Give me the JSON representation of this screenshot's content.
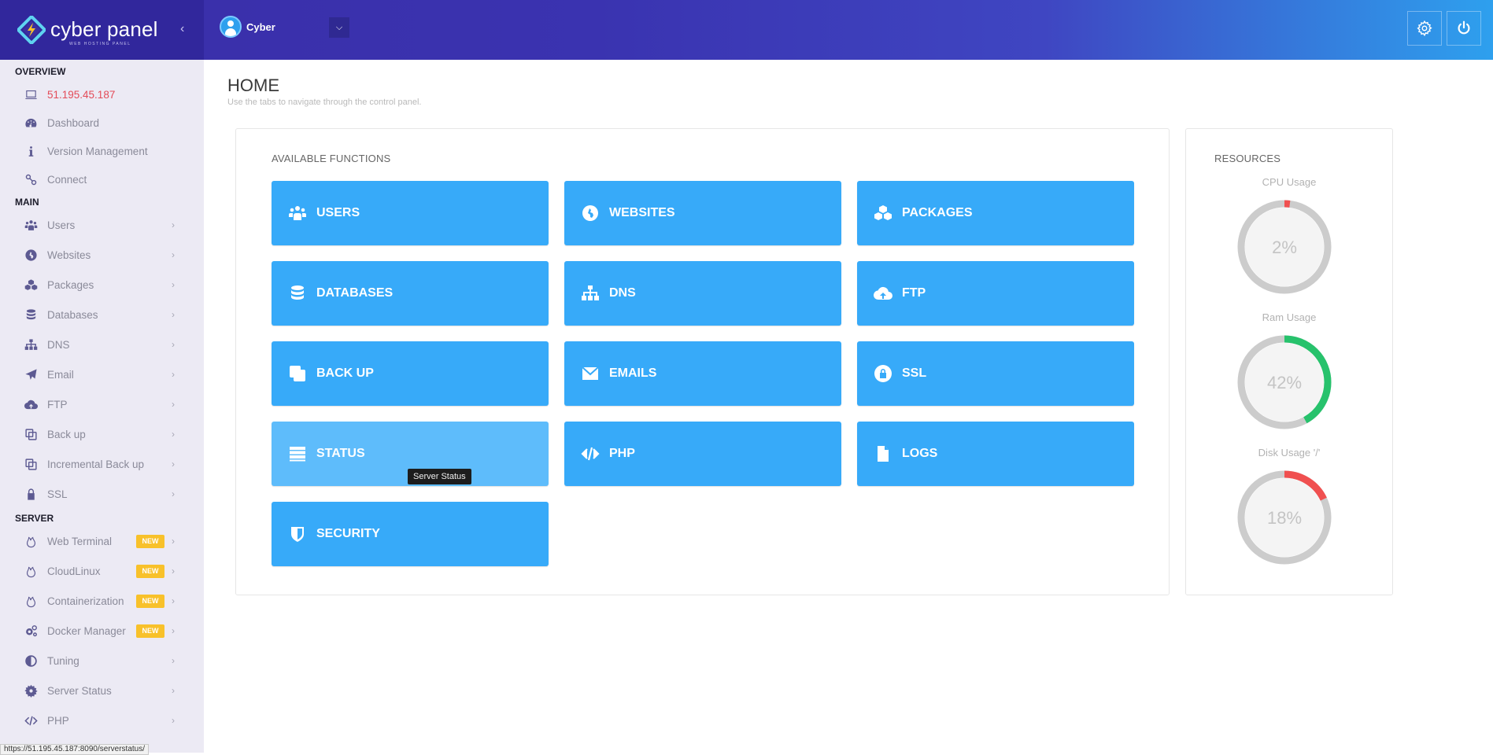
{
  "header": {
    "logo_text": "cyber panel",
    "logo_sub": "WEB HOSTING PANEL",
    "user_name": "Cyber",
    "collapse_icon": "chevron-left-icon",
    "dropdown_icon": "chevron-down-icon",
    "settings_icon": "gear-icon",
    "power_icon": "power-icon"
  },
  "sidebar": {
    "sections": [
      {
        "title": "OVERVIEW",
        "items": [
          {
            "label": "51.195.45.187",
            "icon": "laptop-icon",
            "highlight": true
          },
          {
            "label": "Dashboard",
            "icon": "dashboard-icon"
          },
          {
            "label": "Version Management",
            "icon": "info-icon"
          },
          {
            "label": "Connect",
            "icon": "link-icon"
          }
        ]
      },
      {
        "title": "MAIN",
        "items": [
          {
            "label": "Users",
            "icon": "users-icon",
            "chevron": true
          },
          {
            "label": "Websites",
            "icon": "globe-icon",
            "chevron": true
          },
          {
            "label": "Packages",
            "icon": "cubes-icon",
            "chevron": true
          },
          {
            "label": "Databases",
            "icon": "database-icon",
            "chevron": true
          },
          {
            "label": "DNS",
            "icon": "sitemap-icon",
            "chevron": true
          },
          {
            "label": "Email",
            "icon": "paper-plane-icon",
            "chevron": true
          },
          {
            "label": "FTP",
            "icon": "cloud-upload-icon",
            "chevron": true
          },
          {
            "label": "Back up",
            "icon": "copy-icon",
            "chevron": true
          },
          {
            "label": "Incremental Back up",
            "icon": "copy-icon",
            "chevron": true
          },
          {
            "label": "SSL",
            "icon": "lock-icon",
            "chevron": true
          }
        ]
      },
      {
        "title": "SERVER",
        "items": [
          {
            "label": "Web Terminal",
            "icon": "fire-icon",
            "badge": "NEW",
            "chevron": true
          },
          {
            "label": "CloudLinux",
            "icon": "fire-icon",
            "badge": "NEW",
            "chevron": true
          },
          {
            "label": "Containerization",
            "icon": "fire-icon",
            "badge": "NEW",
            "chevron": true
          },
          {
            "label": "Docker Manager",
            "icon": "cogs-icon",
            "badge": "NEW",
            "chevron": true
          },
          {
            "label": "Tuning",
            "icon": "adjust-icon",
            "chevron": true
          },
          {
            "label": "Server Status",
            "icon": "gear-icon",
            "chevron": true
          },
          {
            "label": "PHP",
            "icon": "code-icon",
            "chevron": true
          }
        ]
      }
    ]
  },
  "status_bar_url": "https://51.195.45.187:8090/serverstatus/",
  "main": {
    "title": "HOME",
    "subtitle": "Use the tabs to navigate through the control panel.",
    "functions_title": "AVAILABLE FUNCTIONS",
    "functions": [
      {
        "label": "USERS",
        "icon": "users-icon"
      },
      {
        "label": "WEBSITES",
        "icon": "globe-icon"
      },
      {
        "label": "PACKAGES",
        "icon": "cubes-icon"
      },
      {
        "label": "DATABASES",
        "icon": "database-icon"
      },
      {
        "label": "DNS",
        "icon": "sitemap-icon"
      },
      {
        "label": "FTP",
        "icon": "cloud-upload-icon"
      },
      {
        "label": "BACK UP",
        "icon": "copy-icon"
      },
      {
        "label": "EMAILS",
        "icon": "envelope-icon"
      },
      {
        "label": "SSL",
        "icon": "lock-icon"
      },
      {
        "label": "STATUS",
        "icon": "server-icon",
        "hovered": true
      },
      {
        "label": "PHP",
        "icon": "code-icon"
      },
      {
        "label": "LOGS",
        "icon": "file-icon"
      },
      {
        "label": "SECURITY",
        "icon": "shield-icon"
      }
    ],
    "tooltip": "Server Status"
  },
  "resources": {
    "title": "RESOURCES",
    "gauges": [
      {
        "label": "CPU Usage",
        "value": 2,
        "display": "2%",
        "color": "#f05050"
      },
      {
        "label": "Ram Usage",
        "value": 42,
        "display": "42%",
        "color": "#27c26c"
      },
      {
        "label": "Disk Usage '/'",
        "value": 18,
        "display": "18%",
        "color": "#f05050"
      }
    ]
  },
  "colors": {
    "tile": "#37aaf9",
    "tile_hover": "#5ebcfb",
    "badge": "#f8c12a",
    "ip_text": "#e34b58",
    "gauge_track": "#cccccc"
  }
}
